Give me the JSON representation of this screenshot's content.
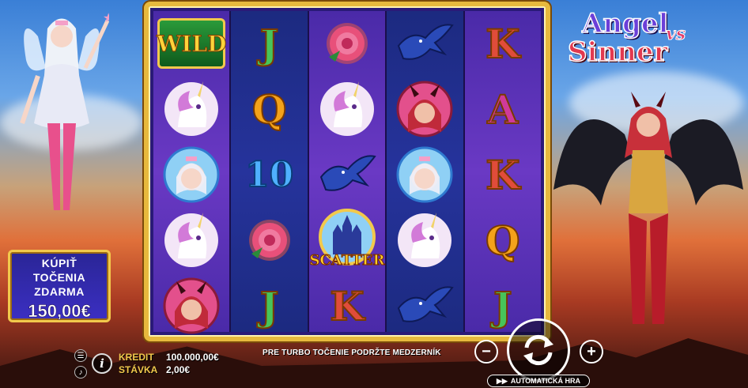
{
  "game": {
    "logo_line1": "Angel",
    "logo_vs": "vs",
    "logo_line2": "Sinner"
  },
  "buy_feature": {
    "line1": "KÚPIŤ",
    "line2": "TOČENIA",
    "line3": "ZDARMA",
    "price": "150,00€"
  },
  "reels": [
    [
      "WILD",
      "unicorn",
      "angel",
      "unicorn",
      "demon"
    ],
    [
      "J",
      "Q",
      "10",
      "rose",
      "J"
    ],
    [
      "rose",
      "unicorn",
      "raven",
      "SCATTER",
      "K"
    ],
    [
      "raven",
      "demon",
      "angel",
      "unicorn",
      "raven"
    ],
    [
      "K",
      "A",
      "K",
      "Q",
      "J"
    ]
  ],
  "symbols": {
    "wild_label": "WILD",
    "scatter_label": "SCATTER"
  },
  "status": {
    "credit_label": "KREDIT",
    "credit_value": "100.000,00€",
    "bet_label": "STÁVKA",
    "bet_value": "2,00€",
    "hint": "PRE TURBO TOČENIE PODRŽTE MEDZERNÍK"
  },
  "controls": {
    "minus_label": "−",
    "plus_label": "+",
    "autoplay_label": "AUTOMATICKÁ HRA",
    "info_label": "i"
  },
  "colors": {
    "frame_gold": "#e7b93d",
    "label_gold": "#f2c94c",
    "reel_dark": "#26339c",
    "reel_light": "#6a39c4"
  }
}
